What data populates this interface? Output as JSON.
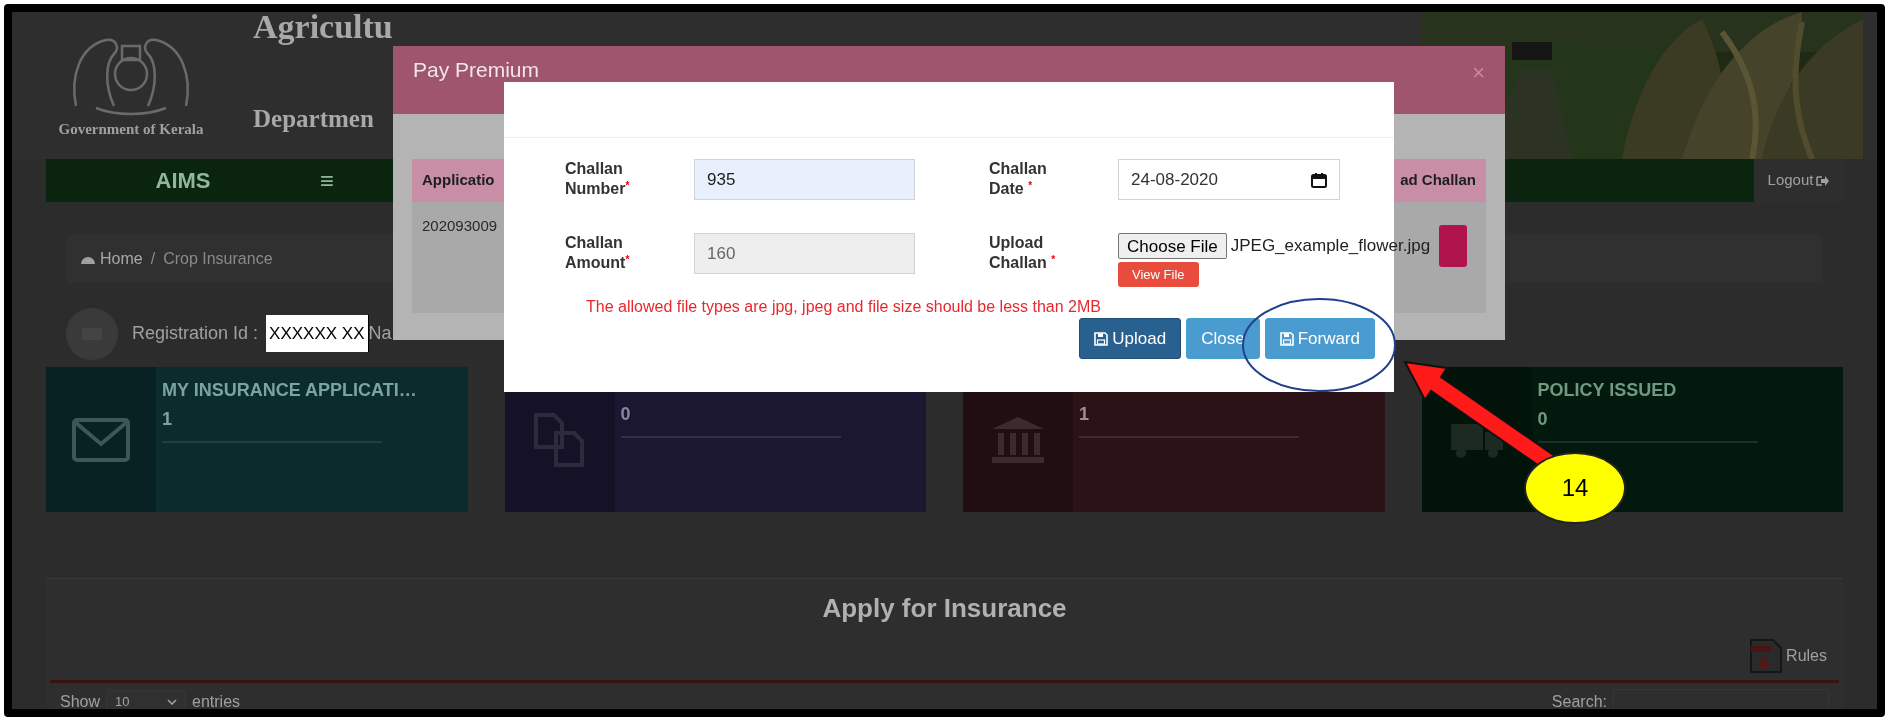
{
  "header": {
    "emblem_caption": "Government of Kerala",
    "title": "Agricultu",
    "subtitle": "Departmen"
  },
  "navbar": {
    "brand": "AIMS",
    "menu_glyph": "≡",
    "logout": "Logout"
  },
  "breadcrumb": {
    "home": "Home",
    "separator": "/",
    "current": "Crop Insurance"
  },
  "registration": {
    "label": "Registration Id :",
    "value": "XXXXXX XX",
    "next_label": "Na"
  },
  "cards": [
    {
      "kind": "envelope",
      "title": "MY INSURANCE APPLICATI…",
      "value": "1",
      "color": "#0b2b2c"
    },
    {
      "kind": "copy",
      "value": "0",
      "color": "#1b1731"
    },
    {
      "kind": "bank",
      "value": "1",
      "color": "#2a1217"
    },
    {
      "kind": "truck",
      "title": "POLICY ISSUED",
      "value": "0",
      "color": "#03190d"
    }
  ],
  "panel": {
    "title": "Apply for Insurance",
    "rules": "Rules",
    "show": "Show",
    "page_size": "10",
    "entries": "entries",
    "search_label": "Search:"
  },
  "pay_premium": {
    "title": "Pay Premium",
    "close_glyph": "×",
    "columns": [
      "Applicatio",
      "ad Challan"
    ],
    "row": [
      "202093009"
    ]
  },
  "challan_form": {
    "fields": [
      {
        "kind": "text",
        "label": "Challan Number$^{*}$",
        "value": "935",
        "autofilled": true,
        "disabled": false
      },
      {
        "kind": "date",
        "label": "Challan Date $^{*}$",
        "value": "24-08-2020"
      },
      {
        "kind": "text",
        "label": "Challan Amount$^{*}$",
        "value": "160",
        "autofilled": false,
        "disabled": true
      },
      {
        "kind": "file",
        "label": "Upload Challan $^{*}$",
        "button": "Choose File",
        "file_name": "JPEG_example_flower.jpg",
        "view_button": "View File"
      }
    ],
    "message": "The allowed file types are jpg, jpeg and file size should be less than 2MB",
    "buttons": [
      {
        "kind": "primary",
        "label": "Upload"
      },
      {
        "kind": "info",
        "label": "Close"
      },
      {
        "kind": "info",
        "label": "Forward"
      }
    ]
  },
  "annotation": {
    "step": "14"
  }
}
